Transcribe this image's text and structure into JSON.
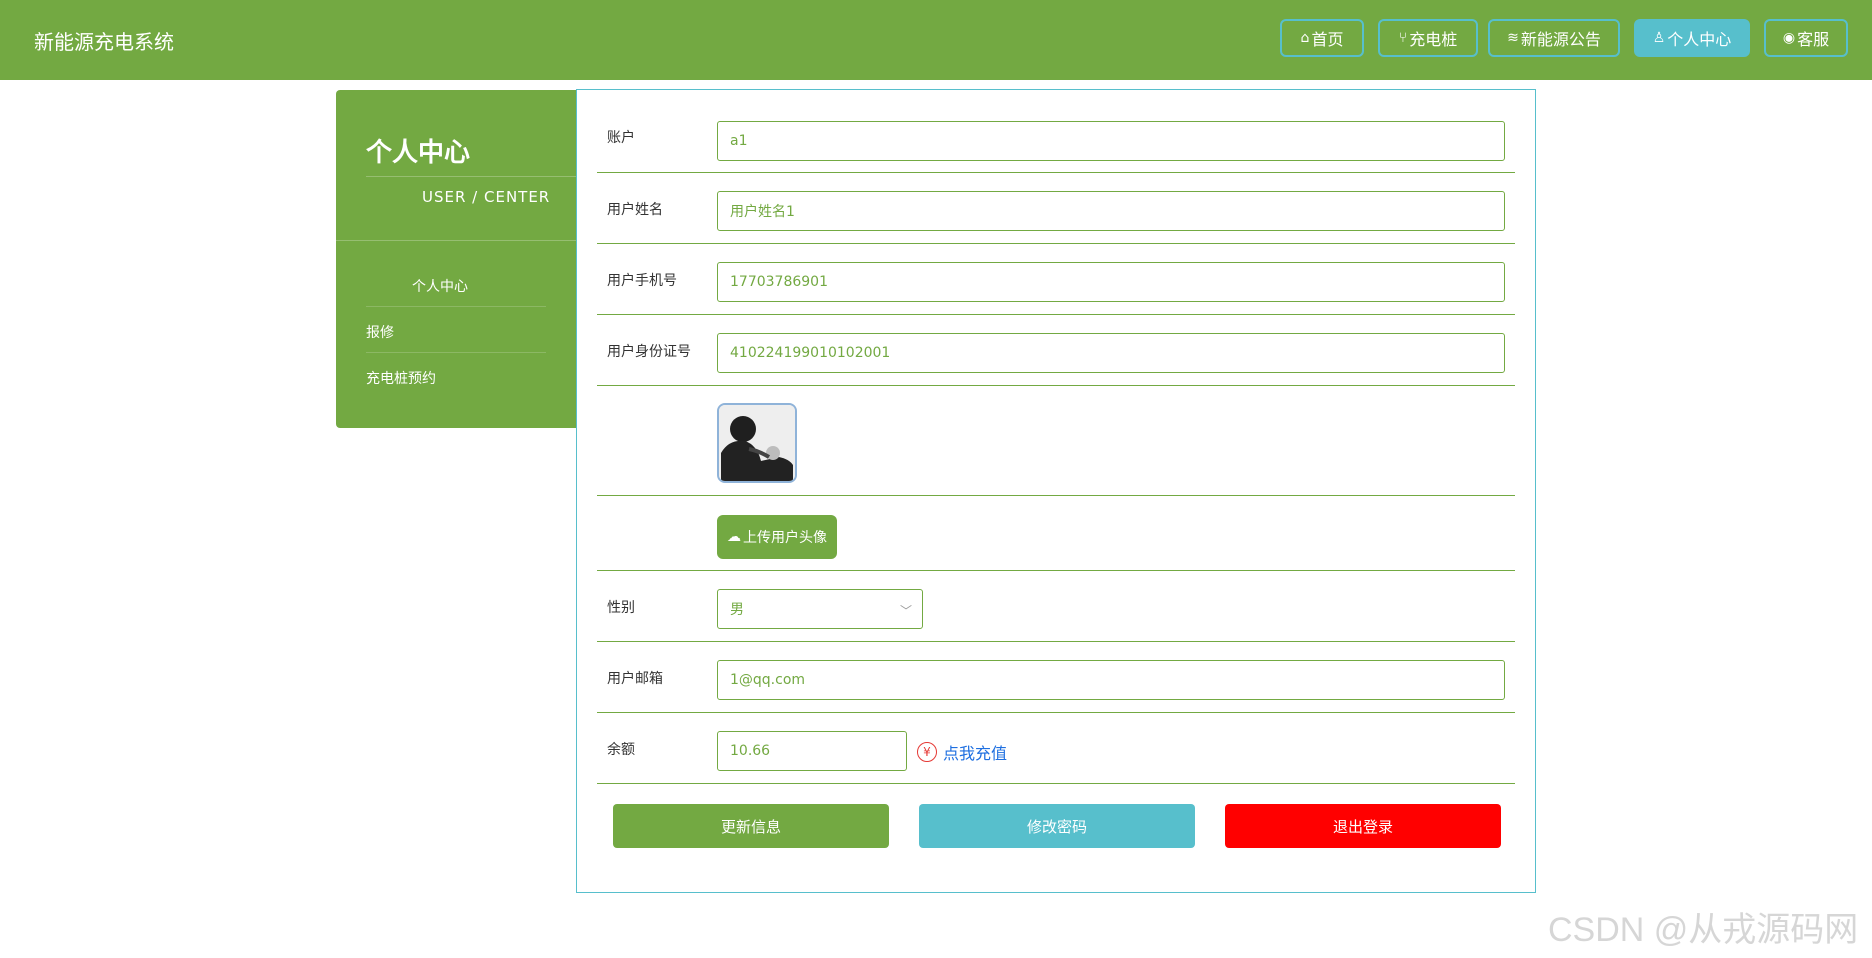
{
  "app": {
    "title": "新能源充电系统"
  },
  "nav": [
    {
      "label": "首页",
      "icon": "home-icon",
      "glyph": "⌂"
    },
    {
      "label": "充电桩",
      "icon": "plug-icon",
      "glyph": "⑂"
    },
    {
      "label": "新能源公告",
      "icon": "layers-icon",
      "glyph": "≋"
    },
    {
      "label": "个人中心",
      "icon": "user-icon",
      "glyph": "♙"
    },
    {
      "label": "客服",
      "icon": "chat-icon",
      "glyph": "◉"
    }
  ],
  "sidebar": {
    "title": "个人中心",
    "subtitle": "USER / CENTER",
    "items": [
      {
        "label": "个人中心"
      },
      {
        "label": "报修"
      },
      {
        "label": "充电桩预约"
      }
    ]
  },
  "form": {
    "account": {
      "label": "账户",
      "value": "a1"
    },
    "name": {
      "label": "用户姓名",
      "value": "用户姓名1"
    },
    "phone": {
      "label": "用户手机号",
      "value": "17703786901"
    },
    "idcard": {
      "label": "用户身份证号",
      "value": "410224199010102001"
    },
    "upload_label": "上传用户头像",
    "gender": {
      "label": "性别",
      "value": "男"
    },
    "email": {
      "label": "用户邮箱",
      "value": "1@qq.com"
    },
    "balance": {
      "label": "余额",
      "value": "10.66",
      "recharge_label": "点我充值"
    }
  },
  "actions": {
    "update": "更新信息",
    "change_password": "修改密码",
    "logout": "退出登录"
  },
  "watermark": "CSDN @从戎源码网",
  "colors": {
    "header": "#73a942",
    "accent": "#57bfcc",
    "danger": "#ff0000"
  }
}
